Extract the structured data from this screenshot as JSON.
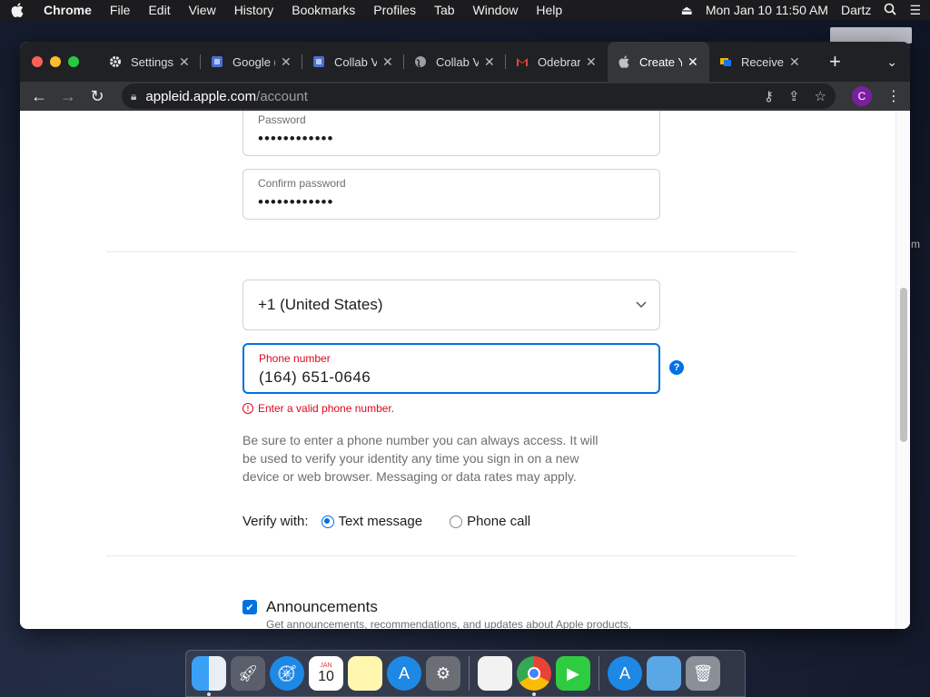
{
  "menubar": {
    "app_name": "Chrome",
    "items": [
      "File",
      "Edit",
      "View",
      "History",
      "Bookmarks",
      "Profiles",
      "Tab",
      "Window",
      "Help"
    ],
    "datetime": "Mon Jan 10  11:50 AM",
    "user": "Dartz"
  },
  "tabs": [
    {
      "label": "Settings",
      "icon": "gear-icon"
    },
    {
      "label": "Google (",
      "icon": "google-meet-icon"
    },
    {
      "label": "Collab V",
      "icon": "google-meet-icon"
    },
    {
      "label": "Collab V",
      "icon": "globe-icon"
    },
    {
      "label": "Odebrar",
      "icon": "gmail-icon"
    },
    {
      "label": "Create Y",
      "icon": "apple-icon",
      "active": true
    },
    {
      "label": "Receive",
      "icon": "sms-icon"
    }
  ],
  "toolbar": {
    "url_host": "appleid.apple.com",
    "url_path": "/account",
    "avatar_letter": "C"
  },
  "form": {
    "password_label": "Password",
    "password_value": "••••••••••••",
    "confirm_label": "Confirm password",
    "confirm_value": "••••••••••••",
    "country_value": "+1 (United States)",
    "phone_label": "Phone number",
    "phone_value": "(164) 651-0646",
    "error_text": "Enter a valid phone number.",
    "info_text": "Be sure to enter a phone number you can always access. It will be used to verify your identity any time you sign in on a new device or web browser. Messaging or data rates may apply.",
    "verify_label": "Verify with:",
    "opt_text": "Text message",
    "opt_call": "Phone call",
    "announce_title": "Announcements",
    "announce_sub": "Get announcements, recommendations, and updates about Apple products,",
    "help": "?"
  },
  "desktop": {
    "side_text": "m"
  },
  "dock": [
    "finder-icon",
    "launchpad-icon",
    "safari-icon",
    "calendar-icon",
    "notes-icon",
    "app-store-icon",
    "system-preferences-icon",
    "textedit-icon",
    "chrome-icon",
    "facetime-icon",
    "app-store-icon",
    "folder-icon",
    "trash-icon"
  ],
  "calendar": {
    "month": "JAN",
    "day": "10"
  },
  "colors": {
    "accent": "#0071e3",
    "error": "#de071c"
  }
}
